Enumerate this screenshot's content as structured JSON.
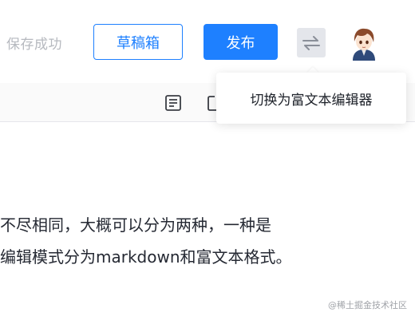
{
  "header": {
    "save_status": "保存成功",
    "draft_button": "草稿箱",
    "publish_button": "发布",
    "switch_editor_icon": "swap-arrows-icon",
    "avatar_icon": "user-avatar"
  },
  "tooltip": {
    "text": "切换为富文本编辑器"
  },
  "toolbar": {
    "icons": [
      "list-icon",
      "image-icon"
    ]
  },
  "editor": {
    "lines": [
      "不尽相同，大概可以分为两种，一种是",
      "编辑模式分为markdown和富文本格式。"
    ]
  },
  "watermark": "@稀土掘金技术社区",
  "colors": {
    "accent": "#1e80ff",
    "muted_text": "#b6b9bf",
    "switch_bg": "#e4e6eb"
  }
}
